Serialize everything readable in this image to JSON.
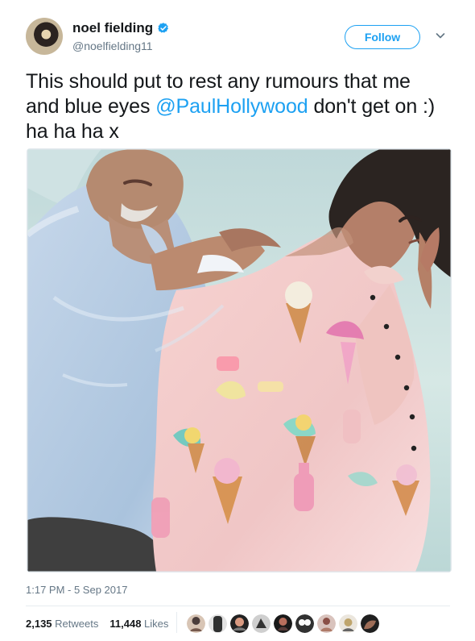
{
  "author": {
    "name": "noel fielding",
    "handle": "@noelfielding11",
    "verified_icon": "verified-badge-icon",
    "avatar_icon": "user-avatar-icon"
  },
  "actions": {
    "follow_label": "Follow",
    "menu_icon": "chevron-down-icon"
  },
  "tweet": {
    "text_before_mention": "This should put to rest any rumours that me and blue eyes ",
    "mention": "@PaulHollywood",
    "text_after_mention": " don't get on :) ha ha ha x",
    "photo_icon": "tweet-photo-icon"
  },
  "meta": {
    "timestamp": "1:17 PM - 5 Sep 2017"
  },
  "stats": {
    "retweets_count": "2,135",
    "retweets_label": "Retweets",
    "likes_count": "11,448",
    "likes_label": "Likes"
  },
  "colors": {
    "accent": "#1da1f2",
    "text": "#14171a",
    "muted": "#657786",
    "border": "#e6ecf0"
  }
}
